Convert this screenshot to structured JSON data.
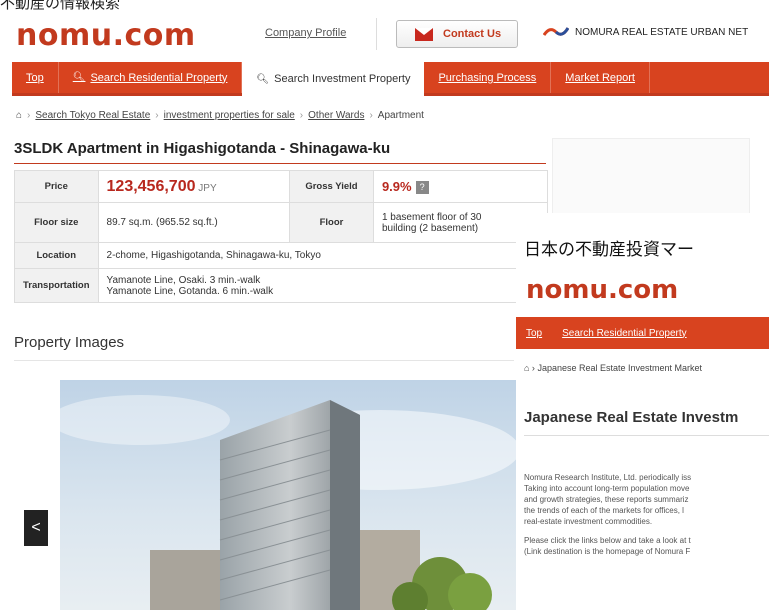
{
  "caption": "不動産の情報検索",
  "header": {
    "logo": "nomu.com",
    "company_profile": "Company Profile",
    "contact_us": "Contact Us",
    "partner_logo": "NOMURA REAL ESTATE URBAN NET"
  },
  "nav": {
    "items": [
      {
        "label": "Top"
      },
      {
        "label": "Search Residential Property"
      },
      {
        "label": "Search Investment Property"
      },
      {
        "label": "Purchasing Process"
      },
      {
        "label": "Market Report"
      }
    ]
  },
  "breadcrumb": [
    "Search Tokyo Real Estate",
    "investment properties for sale",
    "Other Wards",
    "Apartment"
  ],
  "title": "3SLDK Apartment in Higashigotanda - Shinagawa-ku",
  "specs": {
    "price_label": "Price",
    "price_value": "123,456,700",
    "price_unit": "JPY",
    "yield_label": "Gross Yield",
    "yield_value": "9.9%",
    "yield_help": "?",
    "floor_size_label": "Floor size",
    "floor_size_value": "89.7 sq.m. (965.52 sq.ft.)",
    "floor_label": "Floor",
    "floor_value_1": "1 basement floor of 30",
    "floor_value_2": "building (2 basement)",
    "location_label": "Location",
    "location_value": "2-chome, Higashigotanda, Shinagawa-ku, Tokyo",
    "transport_label": "Transportation",
    "transport_line_1": "Yamanote Line, Osaki. 3 min.-walk",
    "transport_line_2": "Yamanote Line, Gotanda. 6 min.-walk"
  },
  "images": {
    "heading": "Property Images",
    "prev": "<"
  },
  "overlay": {
    "title": "日本の不動産投資マー",
    "logo": "nomu.com",
    "nav": [
      "Top",
      "Search Residential Property"
    ],
    "breadcrumb": "Japanese Real Estate Investment Market",
    "heading": "Japanese Real Estate Investm",
    "para1": [
      "Nomura Research Institute, Ltd. periodically iss",
      "Taking into account long-term population move",
      "and growth strategies, these reports summariz",
      "the trends of each of the markets for offices, l",
      "real-estate investment commodities."
    ],
    "para2": [
      "Please click the links below and take a look at t",
      "(Link destination is the homepage of Nomura F"
    ]
  }
}
